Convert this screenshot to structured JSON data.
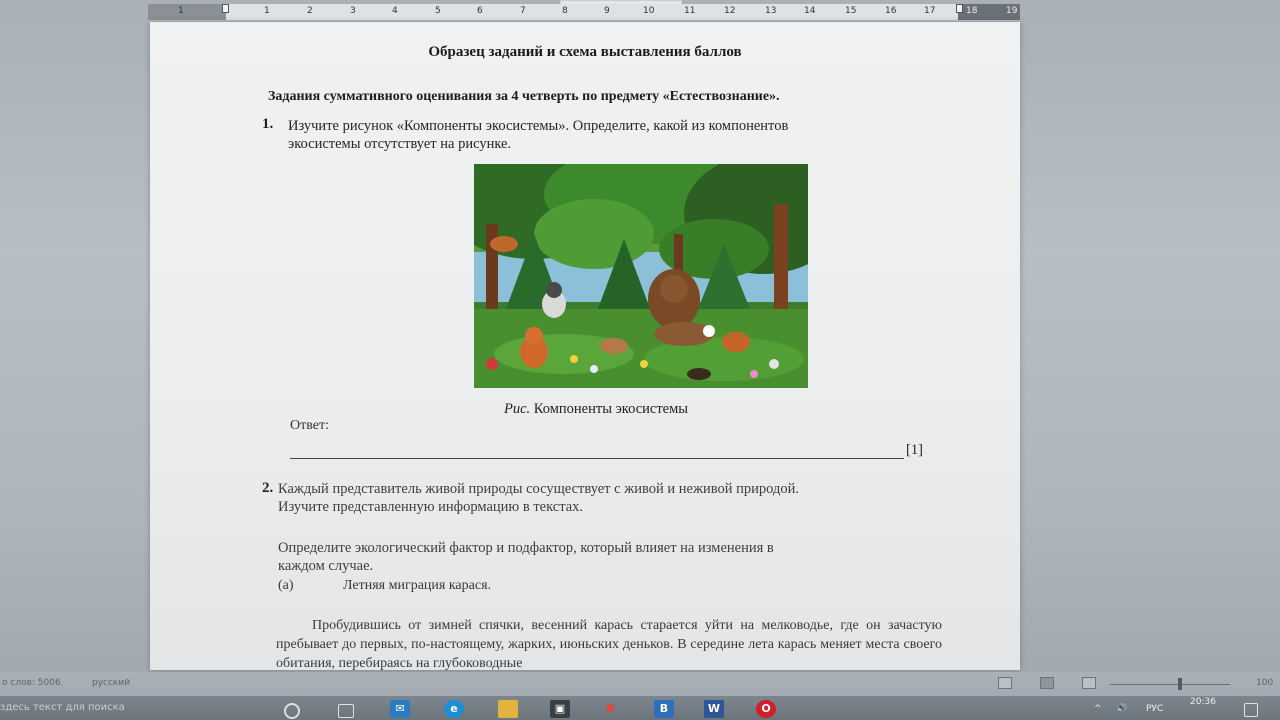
{
  "ruler": {
    "numbers": [
      "1",
      "1",
      "2",
      "3",
      "4",
      "5",
      "6",
      "7",
      "8",
      "9",
      "10",
      "11",
      "12",
      "13",
      "14",
      "15",
      "16",
      "17",
      "18",
      "19"
    ]
  },
  "document": {
    "title": "Образец заданий и схема выставления баллов",
    "subtitle": "Задания суммативного оценивания за 4 четверть по предмету «Естествознание».",
    "q1": {
      "number": "1.",
      "line1": "Изучите рисунок «Компоненты экосистемы». Определите, какой из компонентов",
      "line2": "экосистемы отсутствует на рисунке.",
      "caption_prefix": "Рис.",
      "caption_text": " Компоненты экосистемы",
      "answer_label": "Ответ:",
      "score": "[1]"
    },
    "q2": {
      "number": "2.",
      "line1": "Каждый представитель живой природы сосуществует с живой и неживой природой.",
      "line2": "Изучите представленную информацию в текстах.",
      "line3": "Определите экологический фактор и подфактор, который влияет на изменения  в",
      "line4": "каждом случае.",
      "sub_label": "(a)",
      "sub_title": "Летняя миграция карася.",
      "paragraph": "Пробудившись от зимней спячки, весенний карась старается уйти на мелководье, где он зачастую пребывает до первых, по-настоящему, жарких, июньских деньков. В середине лета карась меняет места своего обитания, перебираясь на глубоководные"
    }
  },
  "statusbar": {
    "words": "о слов: 5006",
    "language": "русский",
    "zoom": "100"
  },
  "taskbar": {
    "search_placeholder": "здесь текст для поиска",
    "yandex_label": "Я",
    "word_label": "W",
    "lang": "РУС",
    "time": "20:36"
  },
  "colors": {
    "page": "#eceeef",
    "desk": "#a9b0b8",
    "taskbar": "#737b84",
    "word_blue": "#2b579a",
    "opera_red": "#d0202a"
  }
}
